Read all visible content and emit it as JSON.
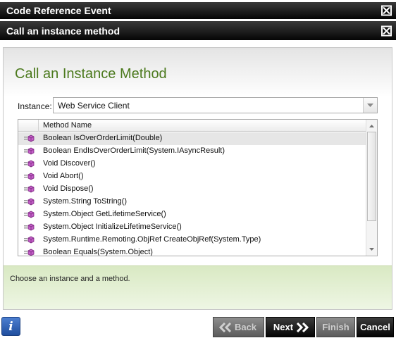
{
  "windows": {
    "outer_title": "Code Reference Event",
    "inner_title": "Call an instance method"
  },
  "page": {
    "heading": "Call an Instance Method"
  },
  "instance": {
    "label": "Instance:",
    "selected": "Web Service Client"
  },
  "methods": {
    "column_header": "Method Name",
    "items": [
      "Boolean IsOverOrderLimit(Double)",
      "Boolean EndIsOverOrderLimit(System.IAsyncResult)",
      "Void Discover()",
      "Void Abort()",
      "Void Dispose()",
      "System.String ToString()",
      "System.Object GetLifetimeService()",
      "System.Object InitializeLifetimeService()",
      "System.Runtime.Remoting.ObjRef CreateObjRef(System.Type)",
      "Boolean Equals(System.Object)"
    ]
  },
  "hint": {
    "text": "Choose an instance and a method."
  },
  "footer": {
    "info_icon": "i",
    "back_label": "Back",
    "next_label": "Next",
    "finish_label": "Finish",
    "cancel_label": "Cancel"
  },
  "colors": {
    "heading": "#4c7a1e",
    "hint_bg": "#d9e9c3"
  }
}
